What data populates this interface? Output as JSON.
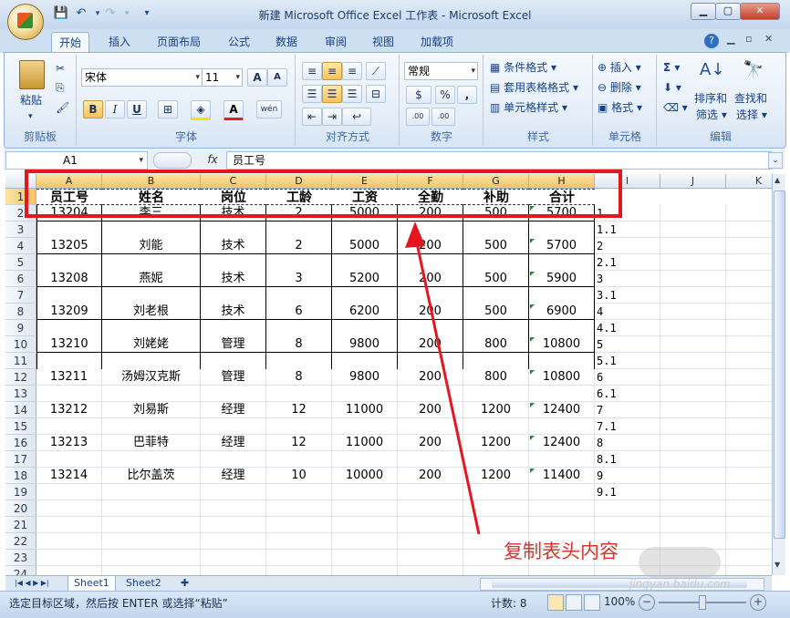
{
  "window": {
    "title": "新建 Microsoft Office Excel 工作表 - Microsoft Excel"
  },
  "tabs": [
    "开始",
    "插入",
    "页面布局",
    "公式",
    "数据",
    "审阅",
    "视图",
    "加载项"
  ],
  "ribbon": {
    "clipboard": {
      "label": "剪贴板",
      "paste": "粘贴"
    },
    "font": {
      "label": "字体",
      "font_name": "宋体",
      "font_size": "11",
      "bold": "B",
      "italic": "I",
      "underline": "U",
      "grow": "A",
      "shrink": "A",
      "font_color": "A",
      "phonetic": "wén"
    },
    "alignment": {
      "label": "对齐方式"
    },
    "number": {
      "label": "数字",
      "format": "常规",
      "percent": "%",
      "comma": ",",
      "inc_dec": ".00",
      "dec_dec": ".00"
    },
    "styles": {
      "label": "样式",
      "conditional": "条件格式",
      "table": "套用表格格式",
      "cell_styles": "单元格样式"
    },
    "cells": {
      "label": "单元格",
      "insert": "插入",
      "delete": "删除",
      "format": "格式"
    },
    "editing": {
      "label": "编辑",
      "sigma": "Σ",
      "sort": "排序和",
      "sort2": "筛选",
      "find": "查找和",
      "find2": "选择"
    }
  },
  "formula_bar": {
    "name_box": "A1",
    "fx": "fx",
    "content": "员工号"
  },
  "columns": [
    "A",
    "B",
    "C",
    "D",
    "E",
    "F",
    "G",
    "H",
    "I",
    "J",
    "K"
  ],
  "header_row": [
    "员工号",
    "姓名",
    "岗位",
    "工龄",
    "工资",
    "全勤",
    "补助",
    "合计"
  ],
  "data_rows": [
    {
      "row": "2",
      "values": [
        "13204",
        "李三",
        "技术",
        "2",
        "5000",
        "200",
        "500",
        "5700"
      ],
      "note": "1"
    },
    {
      "row": "3",
      "values": [
        "",
        "",
        "",
        "",
        "",
        "",
        "",
        ""
      ],
      "note": "1.1"
    },
    {
      "row": "4",
      "values": [
        "13205",
        "刘能",
        "技术",
        "2",
        "5000",
        "200",
        "500",
        "5700"
      ],
      "note": "2"
    },
    {
      "row": "5",
      "values": [
        "",
        "",
        "",
        "",
        "",
        "",
        "",
        ""
      ],
      "note": "2.1"
    },
    {
      "row": "6",
      "values": [
        "13208",
        "燕妮",
        "技术",
        "3",
        "5200",
        "200",
        "500",
        "5900"
      ],
      "note": "3"
    },
    {
      "row": "7",
      "values": [
        "",
        "",
        "",
        "",
        "",
        "",
        "",
        ""
      ],
      "note": "3.1"
    },
    {
      "row": "8",
      "values": [
        "13209",
        "刘老根",
        "技术",
        "6",
        "6200",
        "200",
        "500",
        "6900"
      ],
      "note": "4"
    },
    {
      "row": "9",
      "values": [
        "",
        "",
        "",
        "",
        "",
        "",
        "",
        ""
      ],
      "note": "4.1"
    },
    {
      "row": "10",
      "values": [
        "13210",
        "刘姥姥",
        "管理",
        "8",
        "9800",
        "200",
        "800",
        "10800"
      ],
      "note": "5"
    },
    {
      "row": "11",
      "values": [
        "",
        "",
        "",
        "",
        "",
        "",
        "",
        ""
      ],
      "note": "5.1"
    },
    {
      "row": "12",
      "values": [
        "13211",
        "汤姆汉克斯",
        "管理",
        "8",
        "9800",
        "200",
        "800",
        "10800"
      ],
      "note": "6"
    },
    {
      "row": "13",
      "values": [
        "",
        "",
        "",
        "",
        "",
        "",
        "",
        ""
      ],
      "note": "6.1"
    },
    {
      "row": "14",
      "values": [
        "13212",
        "刘易斯",
        "经理",
        "12",
        "11000",
        "200",
        "1200",
        "12400"
      ],
      "note": "7"
    },
    {
      "row": "15",
      "values": [
        "",
        "",
        "",
        "",
        "",
        "",
        "",
        ""
      ],
      "note": "7.1"
    },
    {
      "row": "16",
      "values": [
        "13213",
        "巴菲特",
        "经理",
        "12",
        "11000",
        "200",
        "1200",
        "12400"
      ],
      "note": "8"
    },
    {
      "row": "17",
      "values": [
        "",
        "",
        "",
        "",
        "",
        "",
        "",
        ""
      ],
      "note": "8.1"
    },
    {
      "row": "18",
      "values": [
        "13214",
        "比尔盖茨",
        "经理",
        "10",
        "10000",
        "200",
        "1200",
        "11400"
      ],
      "note": "9"
    },
    {
      "row": "19",
      "values": [
        "",
        "",
        "",
        "",
        "",
        "",
        "",
        ""
      ],
      "note": "9.1"
    },
    {
      "row": "20",
      "values": [
        "",
        "",
        "",
        "",
        "",
        "",
        "",
        ""
      ],
      "note": ""
    },
    {
      "row": "21",
      "values": [
        "",
        "",
        "",
        "",
        "",
        "",
        "",
        ""
      ],
      "note": ""
    },
    {
      "row": "22",
      "values": [
        "",
        "",
        "",
        "",
        "",
        "",
        "",
        ""
      ],
      "note": ""
    },
    {
      "row": "23",
      "values": [
        "",
        "",
        "",
        "",
        "",
        "",
        "",
        ""
      ],
      "note": ""
    },
    {
      "row": "24",
      "values": [
        "",
        "",
        "",
        "",
        "",
        "",
        "",
        ""
      ],
      "note": ""
    }
  ],
  "sheet_tabs": [
    "Sheet1",
    "Sheet2"
  ],
  "status": {
    "message": "选定目标区域，然后按 ENTER 或选择“粘贴”",
    "count": "计数: 8",
    "zoom": "100%"
  },
  "annotation": "复制表头内容",
  "watermark": "jingyan.baidu.com",
  "colors": {
    "annotation": "#d6362c",
    "selection_box": "#e5161e"
  }
}
